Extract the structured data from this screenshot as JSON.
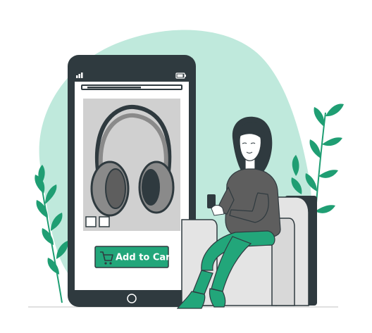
{
  "product": {
    "add_to_cart_label": "Add to Cart",
    "cart_icon": "shopping-cart-icon",
    "thumbnail_count": 2
  },
  "colors": {
    "accent_green": "#22a67a",
    "blob_mint": "#bfe9dc",
    "phone_dark": "#2f3a3f",
    "screen_white": "#ffffff",
    "product_bg": "#d0d0d0",
    "chair_gray": "#e4e4e4",
    "chair_side": "#2f3a3f",
    "sweater_gray": "#5e5e5e",
    "leaf_green": "#1f9e73"
  },
  "icons": {
    "signal": "signal-icon",
    "battery": "battery-icon",
    "home": "home-button-icon",
    "headphones": "headphones-icon"
  }
}
